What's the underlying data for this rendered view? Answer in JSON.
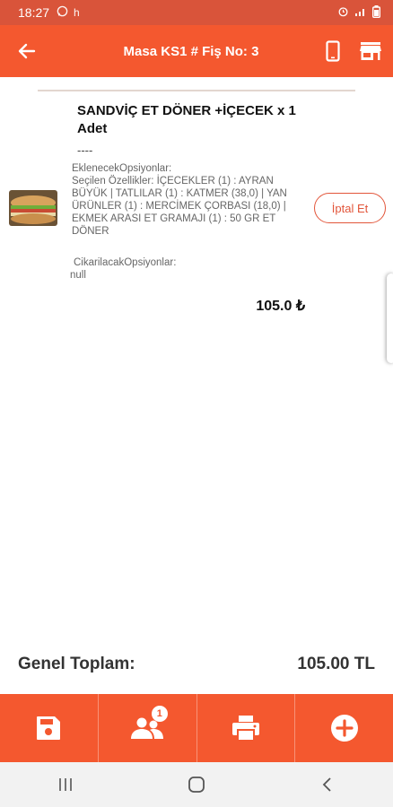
{
  "status_bar": {
    "time": "18:27",
    "network": "h"
  },
  "app_bar": {
    "title": "Masa KS1 # Fiş No: 3"
  },
  "order_item": {
    "name": "SANDVİÇ ET DÖNER +İÇECEK x 1 Adet",
    "separator": "----",
    "added_options_label": "EklenecekOpsiyonlar:",
    "added_options_text": "Seçilen Özellikler: İÇECEKLER (1) : AYRAN BÜYÜK | TATLILAR (1) : KATMER (38,0) | YAN ÜRÜNLER (1) : MERCİMEK ÇORBASI (18,0) | EKMEK ARASI ET GRAMAJI (1) : 50 GR ET DÖNER",
    "removed_options_label": "CikarilacakOpsiyonlar:",
    "removed_options_value": "null",
    "price": "105.0 ₺",
    "cancel_label": "İptal Et"
  },
  "total": {
    "label": "Genel Toplam:",
    "value": "105.00 TL"
  },
  "bottom_bar": {
    "guests_badge": "1"
  },
  "colors": {
    "primary": "#f4582f",
    "status_bar": "#d9543a",
    "accent_text": "#e2553a"
  }
}
